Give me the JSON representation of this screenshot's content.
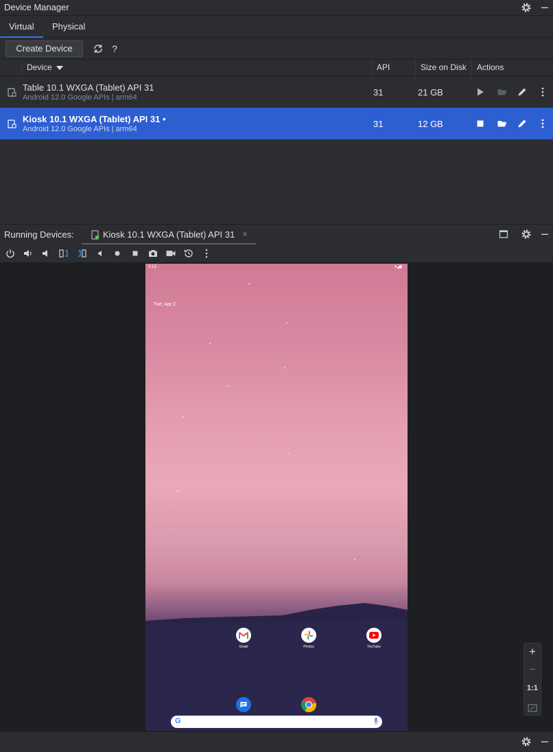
{
  "title_bar": {
    "title": "Device Manager"
  },
  "tabs": [
    {
      "label": "Virtual"
    },
    {
      "label": "Physical"
    }
  ],
  "toolbar": {
    "create_label": "Create Device",
    "help_label": "?"
  },
  "table": {
    "headers": {
      "device": "Device",
      "api": "API",
      "size": "Size on Disk",
      "actions": "Actions"
    },
    "rows": [
      {
        "name": "Table 10.1  WXGA (Tablet) API 31",
        "sub": "Android 12.0 Google APIs | arm64",
        "api": "31",
        "size": "21 GB",
        "selected": false
      },
      {
        "name": "Kiosk 10.1  WXGA (Tablet) API 31  •",
        "sub": "Android 12.0 Google APIs | arm64",
        "api": "31",
        "size": "12 GB",
        "selected": true
      }
    ]
  },
  "running": {
    "label": "Running Devices:",
    "tab_label": "Kiosk 10.1  WXGA (Tablet) API 31",
    "close": "×"
  },
  "emulator": {
    "status_time": "3:13",
    "date": "Tue, Apr 2",
    "apps": [
      {
        "label": "Gmail"
      },
      {
        "label": "Photos"
      },
      {
        "label": "YouTube"
      }
    ]
  },
  "zoom": {
    "in": "+",
    "out": "−",
    "actual": "1:1"
  },
  "colors": {
    "accent": "#3574f0",
    "selected_row": "#2e5fd1",
    "background": "#2b2d30"
  }
}
